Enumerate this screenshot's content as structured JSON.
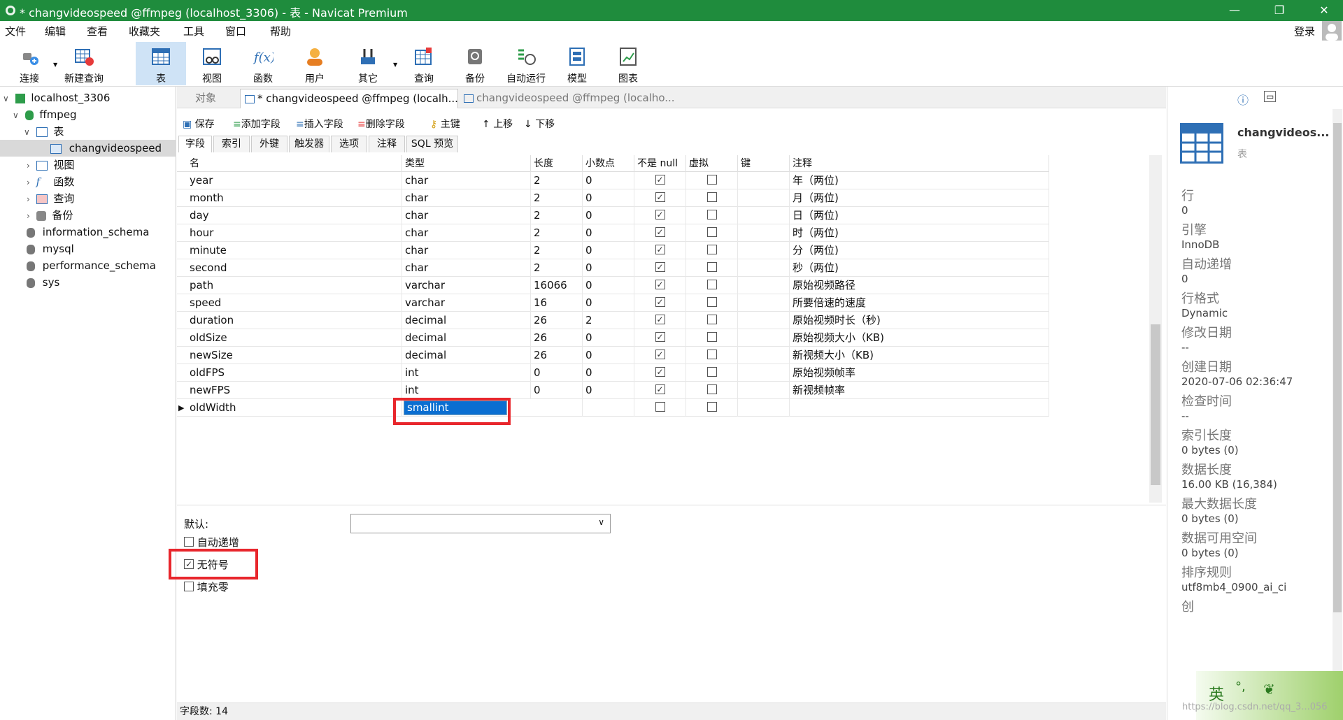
{
  "window": {
    "title": "* changvideospeed @ffmpeg (localhost_3306) - 表 - Navicat Premium",
    "min": "—",
    "max": "❐",
    "close": "✕"
  },
  "menu": [
    "文件",
    "编辑",
    "查看",
    "收藏夹",
    "工具",
    "窗口",
    "帮助"
  ],
  "login": "登录",
  "toolbar": [
    "连接",
    "新建查询",
    "表",
    "视图",
    "函数",
    "用户",
    "其它",
    "查询",
    "备份",
    "自动运行",
    "模型",
    "图表"
  ],
  "nav": {
    "connection": "localhost_3306",
    "db": "ffmpeg",
    "tables_group": "表",
    "table": "changvideospeed",
    "views": "视图",
    "functions": "函数",
    "queries": "查询",
    "backups": "备份",
    "others": [
      "information_schema",
      "mysql",
      "performance_schema",
      "sys"
    ]
  },
  "doc_tabs": [
    "对象",
    "* changvideospeed @ffmpeg (localh...",
    "changvideospeed @ffmpeg (localho..."
  ],
  "editor_toolbar": [
    "保存",
    "添加字段",
    "插入字段",
    "删除字段",
    "主键",
    "上移",
    "下移"
  ],
  "subtabs": [
    "字段",
    "索引",
    "外键",
    "触发器",
    "选项",
    "注释",
    "SQL 预览"
  ],
  "columns": [
    "名",
    "类型",
    "长度",
    "小数点",
    "不是 null",
    "虚拟",
    "键",
    "注释"
  ],
  "fields": [
    {
      "name": "year",
      "type": "char",
      "len": "2",
      "dec": "0",
      "notnull": true,
      "virtual": false,
      "comment": "年（两位)"
    },
    {
      "name": "month",
      "type": "char",
      "len": "2",
      "dec": "0",
      "notnull": true,
      "virtual": false,
      "comment": "月（两位)"
    },
    {
      "name": "day",
      "type": "char",
      "len": "2",
      "dec": "0",
      "notnull": true,
      "virtual": false,
      "comment": "日（两位)"
    },
    {
      "name": "hour",
      "type": "char",
      "len": "2",
      "dec": "0",
      "notnull": true,
      "virtual": false,
      "comment": "时（两位)"
    },
    {
      "name": "minute",
      "type": "char",
      "len": "2",
      "dec": "0",
      "notnull": true,
      "virtual": false,
      "comment": "分（两位)"
    },
    {
      "name": "second",
      "type": "char",
      "len": "2",
      "dec": "0",
      "notnull": true,
      "virtual": false,
      "comment": "秒（两位)"
    },
    {
      "name": "path",
      "type": "varchar",
      "len": "16066",
      "dec": "0",
      "notnull": true,
      "virtual": false,
      "comment": "原始视频路径"
    },
    {
      "name": "speed",
      "type": "varchar",
      "len": "16",
      "dec": "0",
      "notnull": true,
      "virtual": false,
      "comment": "所要倍速的速度"
    },
    {
      "name": "duration",
      "type": "decimal",
      "len": "26",
      "dec": "2",
      "notnull": true,
      "virtual": false,
      "comment": "原始视频时长（秒)"
    },
    {
      "name": "oldSize",
      "type": "decimal",
      "len": "26",
      "dec": "0",
      "notnull": true,
      "virtual": false,
      "comment": "原始视频大小（KB)"
    },
    {
      "name": "newSize",
      "type": "decimal",
      "len": "26",
      "dec": "0",
      "notnull": true,
      "virtual": false,
      "comment": "新视频大小（KB)"
    },
    {
      "name": "oldFPS",
      "type": "int",
      "len": "0",
      "dec": "0",
      "notnull": true,
      "virtual": false,
      "comment": "原始视频帧率"
    },
    {
      "name": "newFPS",
      "type": "int",
      "len": "0",
      "dec": "0",
      "notnull": true,
      "virtual": false,
      "comment": "新视频帧率"
    },
    {
      "name": "oldWidth",
      "type": "smallint",
      "len": "",
      "dec": "",
      "notnull": false,
      "virtual": false,
      "comment": "",
      "editing": true
    }
  ],
  "bottom": {
    "default_label": "默认:",
    "auto_inc": "自动递增",
    "unsigned": "无符号",
    "zerofill": "填充零",
    "unsigned_checked": true
  },
  "status": "字段数: 14",
  "side": {
    "name": "changvideos...",
    "kind": "表",
    "props": [
      {
        "label": "行",
        "value": "0"
      },
      {
        "label": "引擎",
        "value": "InnoDB"
      },
      {
        "label": "自动递增",
        "value": "0"
      },
      {
        "label": "行格式",
        "value": "Dynamic"
      },
      {
        "label": "修改日期",
        "value": "--"
      },
      {
        "label": "创建日期",
        "value": "2020-07-06 02:36:47"
      },
      {
        "label": "检查时间",
        "value": "--"
      },
      {
        "label": "索引长度",
        "value": "0 bytes (0)"
      },
      {
        "label": "数据长度",
        "value": "16.00 KB (16,384)"
      },
      {
        "label": "最大数据长度",
        "value": "0 bytes (0)"
      },
      {
        "label": "数据可用空间",
        "value": "0 bytes (0)"
      },
      {
        "label": "排序规则",
        "value": "utf8mb4_0900_ai_ci"
      }
    ],
    "next_label": "创"
  },
  "ime": {
    "lang": "英",
    "punct": "°,"
  },
  "watermark": "https://blog.csdn.net/qq_3...056",
  "colors": {
    "title_bg": "#1f8c3d",
    "active_tool": "#cfe3f6",
    "highlight": "#e8262c",
    "edit_bg": "#0a6ed1"
  }
}
